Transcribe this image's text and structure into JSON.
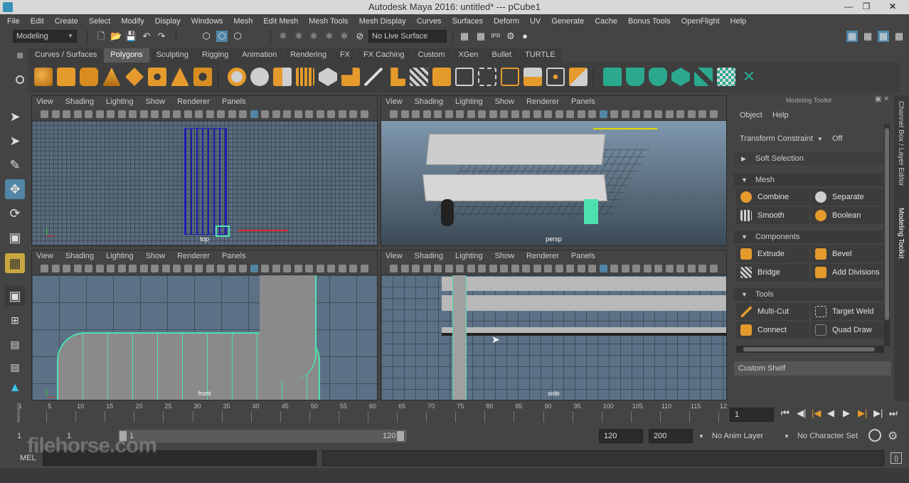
{
  "window": {
    "title": "Autodesk Maya 2016: untitled*   ---   pCube1"
  },
  "menubar": [
    "File",
    "Edit",
    "Create",
    "Select",
    "Modify",
    "Display",
    "Windows",
    "Mesh",
    "Edit Mesh",
    "Mesh Tools",
    "Mesh Display",
    "Curves",
    "Surfaces",
    "Deform",
    "UV",
    "Generate",
    "Cache",
    "Bonus Tools",
    "OpenFlight",
    "Help"
  ],
  "status": {
    "menuset": "Modeling",
    "live_surface": "No Live Surface"
  },
  "shelf": {
    "tabs": [
      "Curves / Surfaces",
      "Polygons",
      "Sculpting",
      "Rigging",
      "Animation",
      "Rendering",
      "FX",
      "FX Caching",
      "Custom",
      "XGen",
      "Bullet",
      "TURTLE"
    ],
    "active_tab": "Polygons"
  },
  "viewport_menu": [
    "View",
    "Shading",
    "Lighting",
    "Show",
    "Renderer",
    "Panels"
  ],
  "viewports": {
    "top": "top",
    "persp": "persp",
    "front": "front",
    "side": "side"
  },
  "modeling_toolkit": {
    "title": "Modeling Toolkit",
    "menu": [
      "Object",
      "Help"
    ],
    "transform_constraint_label": "Transform Constraint",
    "transform_constraint_value": "Off",
    "soft_selection": "Soft Selection",
    "sections": {
      "mesh": "Mesh",
      "components": "Components",
      "tools": "Tools"
    },
    "mesh_buttons": [
      "Combine",
      "Separate",
      "Smooth",
      "Boolean"
    ],
    "component_buttons": [
      "Extrude",
      "Bevel",
      "Bridge",
      "Add Divisions"
    ],
    "tool_buttons": [
      "Multi-Cut",
      "Target Weld",
      "Connect",
      "Quad Draw"
    ],
    "custom_shelf": "Custom Shelf"
  },
  "side_tabs": {
    "channel_box": "Channel Box / Layer Editor",
    "modeling_toolkit": "Modeling Toolkit"
  },
  "timeline": {
    "ticks": [
      "1",
      "5",
      "10",
      "15",
      "20",
      "25",
      "30",
      "35",
      "40",
      "45",
      "50",
      "55",
      "60",
      "65",
      "70",
      "75",
      "80",
      "85",
      "90",
      "95",
      "100",
      "105",
      "110",
      "115",
      "12"
    ],
    "current_frame": "1"
  },
  "range": {
    "start": "1",
    "inner_start": "1",
    "inner_start2": "1",
    "inner_end": "120",
    "end": "120",
    "max_end": "200",
    "anim_layer": "No Anim Layer",
    "char_set": "No Character Set"
  },
  "mel": {
    "label": "MEL"
  },
  "watermark": "filehorse.com",
  "colors": {
    "accent_blue": "#5285a6",
    "wire_green": "#4fe0b0",
    "active_tab": "#5a5a5a"
  }
}
